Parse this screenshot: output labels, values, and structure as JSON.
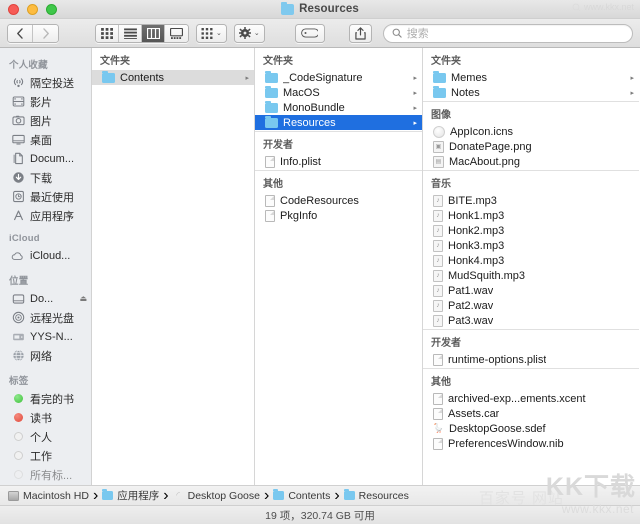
{
  "window": {
    "title": "Resources",
    "title_icon": "folder-icon",
    "traffic_lights": [
      "close-button",
      "minimize-button",
      "zoom-button"
    ]
  },
  "toolbar": {
    "back_label": "‹",
    "forward_label": "›",
    "view_modes": [
      {
        "name": "icon-view",
        "selected": false
      },
      {
        "name": "list-view",
        "selected": false
      },
      {
        "name": "column-view",
        "selected": true
      },
      {
        "name": "gallery-view",
        "selected": false
      }
    ],
    "group_label": "group-icon",
    "action_label": "gear-icon",
    "tag_label": "tag-icon",
    "share_label": "share-icon",
    "chevron": "⌄"
  },
  "search": {
    "placeholder": "搜索",
    "value": "",
    "icon": "search-icon"
  },
  "sidebar": {
    "sections": [
      {
        "header": "个人收藏",
        "items": [
          {
            "label": "隔空投送",
            "icon": "airdrop-icon"
          },
          {
            "label": "影片",
            "icon": "movies-icon"
          },
          {
            "label": "图片",
            "icon": "pictures-icon"
          },
          {
            "label": "桌面",
            "icon": "desktop-icon"
          },
          {
            "label": "Docum...",
            "icon": "documents-icon"
          },
          {
            "label": "下载",
            "icon": "downloads-icon"
          },
          {
            "label": "最近使用",
            "icon": "recents-icon"
          },
          {
            "label": "应用程序",
            "icon": "applications-icon"
          }
        ]
      },
      {
        "header": "iCloud",
        "items": [
          {
            "label": "iCloud...",
            "icon": "icloud-icon"
          }
        ]
      },
      {
        "header": "位置",
        "items": [
          {
            "label": "Do...",
            "icon": "disk-icon",
            "eject": "⏏"
          },
          {
            "label": "远程光盘",
            "icon": "optical-disc-icon"
          },
          {
            "label": "YYS-N...",
            "icon": "server-icon"
          },
          {
            "label": "网络",
            "icon": "network-icon"
          }
        ]
      },
      {
        "header": "标签",
        "items": [
          {
            "label": "看完的书",
            "icon": "tag-dot-green",
            "color": "#3fc13b"
          },
          {
            "label": "读书",
            "icon": "tag-dot-red",
            "color": "#e0493a"
          },
          {
            "label": "个人",
            "icon": "tag-dot-gray"
          },
          {
            "label": "工作",
            "icon": "tag-dot-gray"
          },
          {
            "label": "所有标...",
            "icon": "tag-dot-gray"
          }
        ]
      }
    ]
  },
  "columns": [
    {
      "groups": [
        {
          "header": "文件夹",
          "rows": [
            {
              "name": "Contents",
              "icon": "folder-icon",
              "arrow": "▸",
              "state": "selected-inactive"
            }
          ]
        }
      ]
    },
    {
      "groups": [
        {
          "header": "文件夹",
          "rows": [
            {
              "name": "_CodeSignature",
              "icon": "folder-icon",
              "arrow": "▸",
              "state": "normal"
            },
            {
              "name": "MacOS",
              "icon": "folder-icon",
              "arrow": "▸",
              "state": "normal"
            },
            {
              "name": "MonoBundle",
              "icon": "folder-icon",
              "arrow": "▸",
              "state": "normal"
            },
            {
              "name": "Resources",
              "icon": "folder-icon",
              "arrow": "▸",
              "state": "selected-active"
            }
          ]
        },
        {
          "header": "开发者",
          "rows": [
            {
              "name": "Info.plist",
              "icon": "document-icon",
              "arrow": "",
              "state": "normal"
            }
          ]
        },
        {
          "header": "其他",
          "rows": [
            {
              "name": "CodeResources",
              "icon": "document-icon",
              "arrow": "",
              "state": "normal"
            },
            {
              "name": "PkgInfo",
              "icon": "document-icon",
              "arrow": "",
              "state": "normal"
            }
          ]
        }
      ]
    },
    {
      "groups": [
        {
          "header": "文件夹",
          "rows": [
            {
              "name": "Memes",
              "icon": "folder-icon",
              "arrow": "▸",
              "state": "normal"
            },
            {
              "name": "Notes",
              "icon": "folder-icon",
              "arrow": "▸",
              "state": "normal"
            }
          ]
        },
        {
          "header": "图像",
          "rows": [
            {
              "name": "AppIcon.icns",
              "icon": "icns-icon",
              "arrow": "",
              "state": "normal"
            },
            {
              "name": "DonatePage.png",
              "icon": "image-icon",
              "arrow": "",
              "state": "normal"
            },
            {
              "name": "MacAbout.png",
              "icon": "image-icon",
              "arrow": "",
              "state": "normal"
            }
          ]
        },
        {
          "header": "音乐",
          "rows": [
            {
              "name": "BITE.mp3",
              "icon": "sound-icon",
              "arrow": "",
              "state": "normal"
            },
            {
              "name": "Honk1.mp3",
              "icon": "sound-icon",
              "arrow": "",
              "state": "normal"
            },
            {
              "name": "Honk2.mp3",
              "icon": "sound-icon",
              "arrow": "",
              "state": "normal"
            },
            {
              "name": "Honk3.mp3",
              "icon": "sound-icon",
              "arrow": "",
              "state": "normal"
            },
            {
              "name": "Honk4.mp3",
              "icon": "sound-icon",
              "arrow": "",
              "state": "normal"
            },
            {
              "name": "MudSquith.mp3",
              "icon": "sound-icon",
              "arrow": "",
              "state": "normal"
            },
            {
              "name": "Pat1.wav",
              "icon": "sound-icon",
              "arrow": "",
              "state": "normal"
            },
            {
              "name": "Pat2.wav",
              "icon": "sound-icon",
              "arrow": "",
              "state": "normal"
            },
            {
              "name": "Pat3.wav",
              "icon": "sound-icon",
              "arrow": "",
              "state": "normal"
            }
          ]
        },
        {
          "header": "开发者",
          "rows": [
            {
              "name": "runtime-options.plist",
              "icon": "document-icon",
              "arrow": "",
              "state": "normal"
            }
          ]
        },
        {
          "header": "其他",
          "rows": [
            {
              "name": "archived-exp...ements.xcent",
              "icon": "document-icon",
              "arrow": "",
              "state": "normal"
            },
            {
              "name": "Assets.car",
              "icon": "document-icon",
              "arrow": "",
              "state": "normal"
            },
            {
              "name": "DesktopGoose.sdef",
              "icon": "goose-icon",
              "arrow": "",
              "state": "normal"
            },
            {
              "name": "PreferencesWindow.nib",
              "icon": "document-icon",
              "arrow": "",
              "state": "normal"
            }
          ]
        }
      ]
    }
  ],
  "pathbar": {
    "crumbs": [
      {
        "label": "Macintosh HD",
        "icon": "harddisk-icon"
      },
      {
        "label": "应用程序",
        "icon": "folder-icon"
      },
      {
        "label": "Desktop Goose",
        "icon": "app-icon"
      },
      {
        "label": "Contents",
        "icon": "folder-icon"
      },
      {
        "label": "Resources",
        "icon": "folder-icon"
      }
    ],
    "separator": "›"
  },
  "statusbar": {
    "text": "19 项，320.74 GB 可用"
  },
  "watermarks": {
    "top_right": "www.kkx.net",
    "bottom_right_big": "KK下载",
    "bottom_right_small": "www.kkx.net",
    "bottom_center": "百家号 网站"
  },
  "colors": {
    "accent": "#1f6fe0",
    "sidebar_bg": "#eceef1",
    "folder_blue": "#79c8ef"
  }
}
